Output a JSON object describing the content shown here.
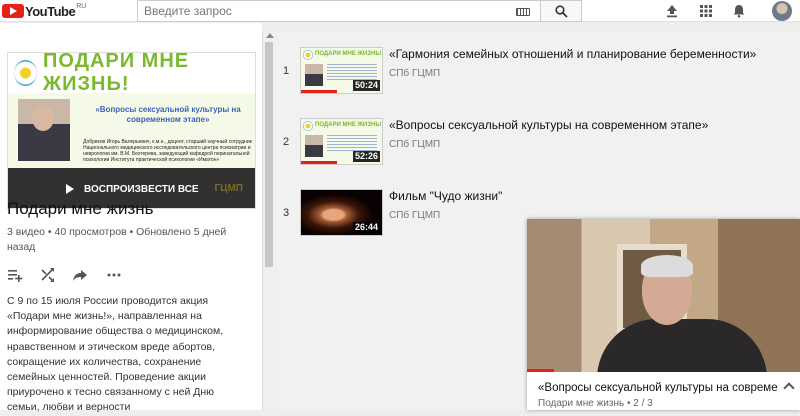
{
  "header": {
    "logo_text": "YouTube",
    "logo_region": "RU",
    "search_placeholder": "Введите запрос"
  },
  "playlist": {
    "thumbnail": {
      "banner": "ПОДАРИ МНЕ ЖИЗНЬ!",
      "subtitle": "«Вопросы сексуальной культуры на современном этапе»",
      "caption": "Добряков Игорь Валерьевич, к.м.н., доцент, старший научный сотрудник Национального медицинского исследовательского центра психиатрии и неврологии им. В.М. Бехтерева, заведующий кафедрой перинатальной психологии Института практической психологии «Иматон»",
      "watermark": "ГЦМП"
    },
    "play_all_label": "ВОСПРОИЗВЕСТИ ВСЕ",
    "title": "Подари мне жизнь",
    "meta": "3 видео • 40 просмотров • Обновлено 5 дней назад",
    "actions": [
      "add-to-playlist-icon",
      "shuffle-icon",
      "share-icon",
      "more-icon"
    ],
    "description": "С 9 по 15 июля  России проводится акция «Подари мне жизнь!», направленная на информирование общества о медицинском, нравственном и этическом вреде абортов, сокращение их количества, сохранение семейных ценностей. Проведение акции приурочено к тесно связанному с ней Дню семьи, любви и верности"
  },
  "videos": [
    {
      "index": "1",
      "title": "«Гармония семейных отношений и планирование беременности»",
      "channel": "СПб ГЦМП",
      "duration": "50:24",
      "progress": 0.45
    },
    {
      "index": "2",
      "title": "«Вопросы сексуальной культуры на современном этапе»",
      "channel": "СПб ГЦМП",
      "duration": "52:26",
      "progress": 0.45
    },
    {
      "index": "3",
      "title": "Фильм \"Чудо жизни\"",
      "channel": "СПб ГЦМП",
      "duration": "26:44",
      "progress": 0
    }
  ],
  "mini_player": {
    "title": "«Вопросы сексуальной культуры на современном",
    "subtitle": "Подари мне жизнь • 2 / 3",
    "progress": 0.1
  },
  "colors": {
    "brand_red": "#e62117",
    "banner_green": "#7cb82f",
    "subtitle_blue": "#3b63b6"
  }
}
